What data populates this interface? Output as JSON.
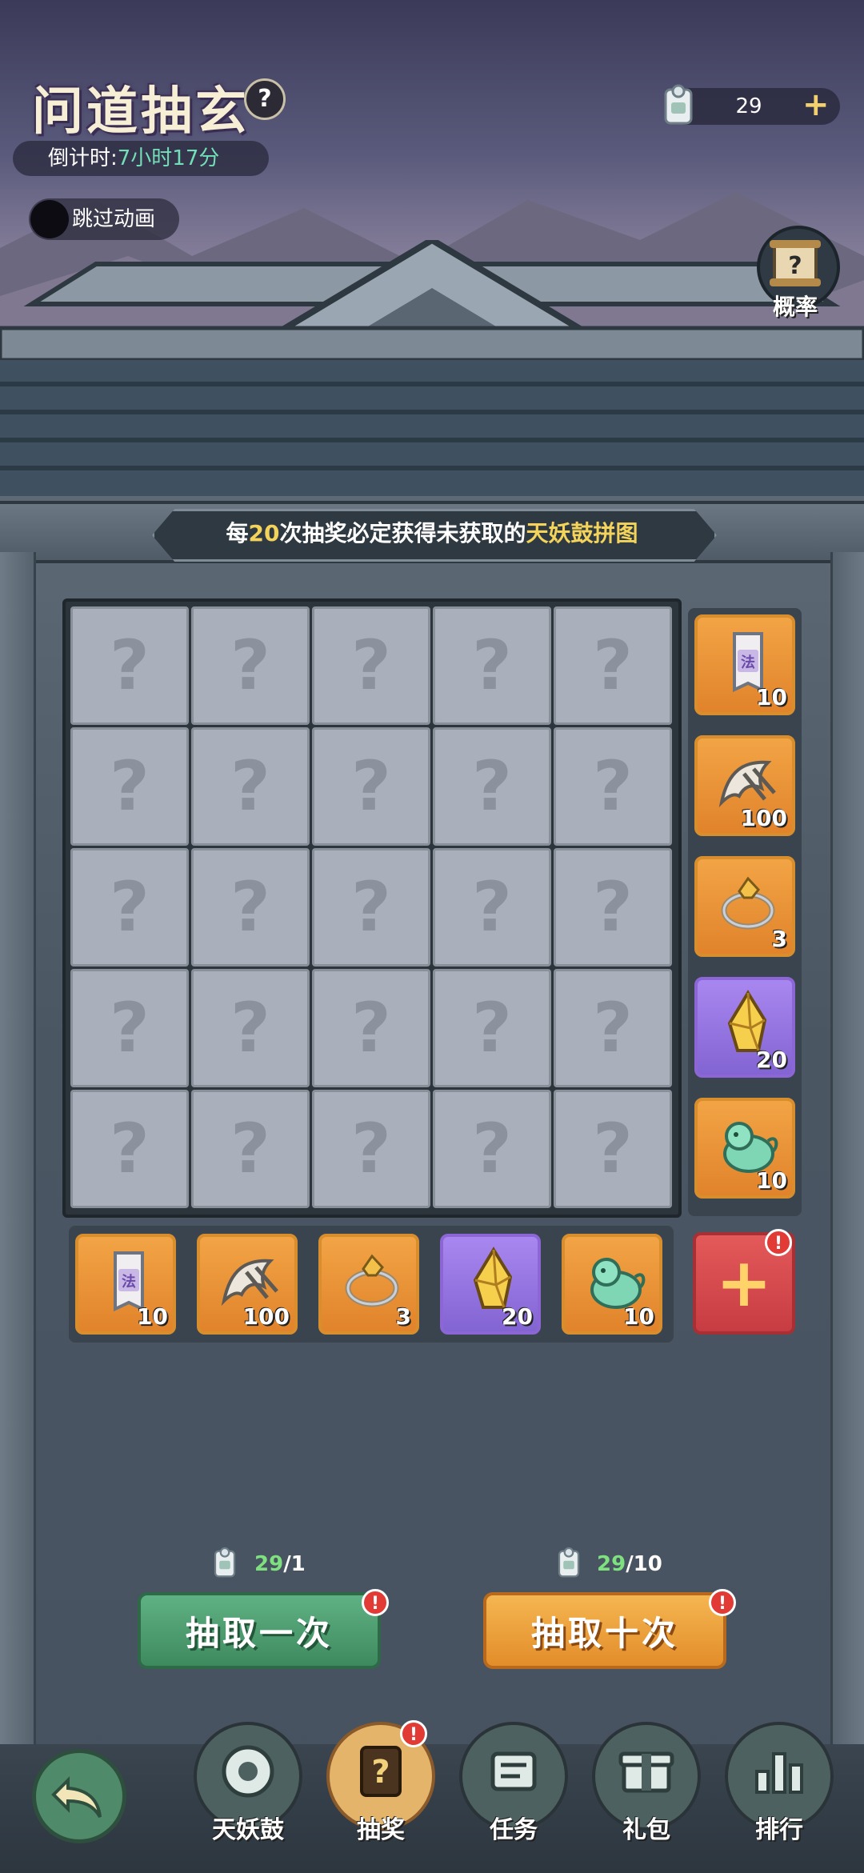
{
  "header": {
    "title": "问道抽玄",
    "help_icon": "?",
    "countdown_label": "倒计时:",
    "countdown_value": "7小时17分",
    "skip_label": "跳过动画",
    "currency_value": "29",
    "currency_plus": "+",
    "probability_label": "概率"
  },
  "banner": {
    "prefix": "每",
    "number": "20",
    "middle": "次抽奖必定获得未获取的",
    "highlight": "天妖鼓拼图"
  },
  "puzzle": {
    "piece_mark": "?",
    "count": 25
  },
  "side_rewards": [
    {
      "icon": "talisman-icon",
      "count": "10"
    },
    {
      "icon": "claw-icon",
      "count": "100"
    },
    {
      "icon": "ring-icon",
      "count": "3"
    },
    {
      "icon": "crystal-icon",
      "count": "20"
    },
    {
      "icon": "jade-lion-icon",
      "count": "10"
    }
  ],
  "bottom_rewards": [
    {
      "icon": "talisman-icon",
      "count": "10"
    },
    {
      "icon": "claw-icon",
      "count": "100"
    },
    {
      "icon": "ring-icon",
      "count": "3"
    },
    {
      "icon": "crystal-icon",
      "count": "20"
    },
    {
      "icon": "jade-lion-icon",
      "count": "10"
    }
  ],
  "add_button_label": "+",
  "draw": {
    "one": {
      "have": "29",
      "need": "/1",
      "label": "抽取一次"
    },
    "ten": {
      "have": "29",
      "need": "/10",
      "label": "抽取十次"
    },
    "badge": "!"
  },
  "nav": {
    "items": [
      {
        "label": "天妖鼓"
      },
      {
        "label": "抽奖"
      },
      {
        "label": "任务"
      },
      {
        "label": "礼包"
      },
      {
        "label": "排行"
      }
    ]
  },
  "colors": {
    "accent_gold": "#f3d35a",
    "green_button": "#4f9e71",
    "orange_button": "#eca03d",
    "purple_card": "#9276e0",
    "orange_card": "#ea9638"
  }
}
